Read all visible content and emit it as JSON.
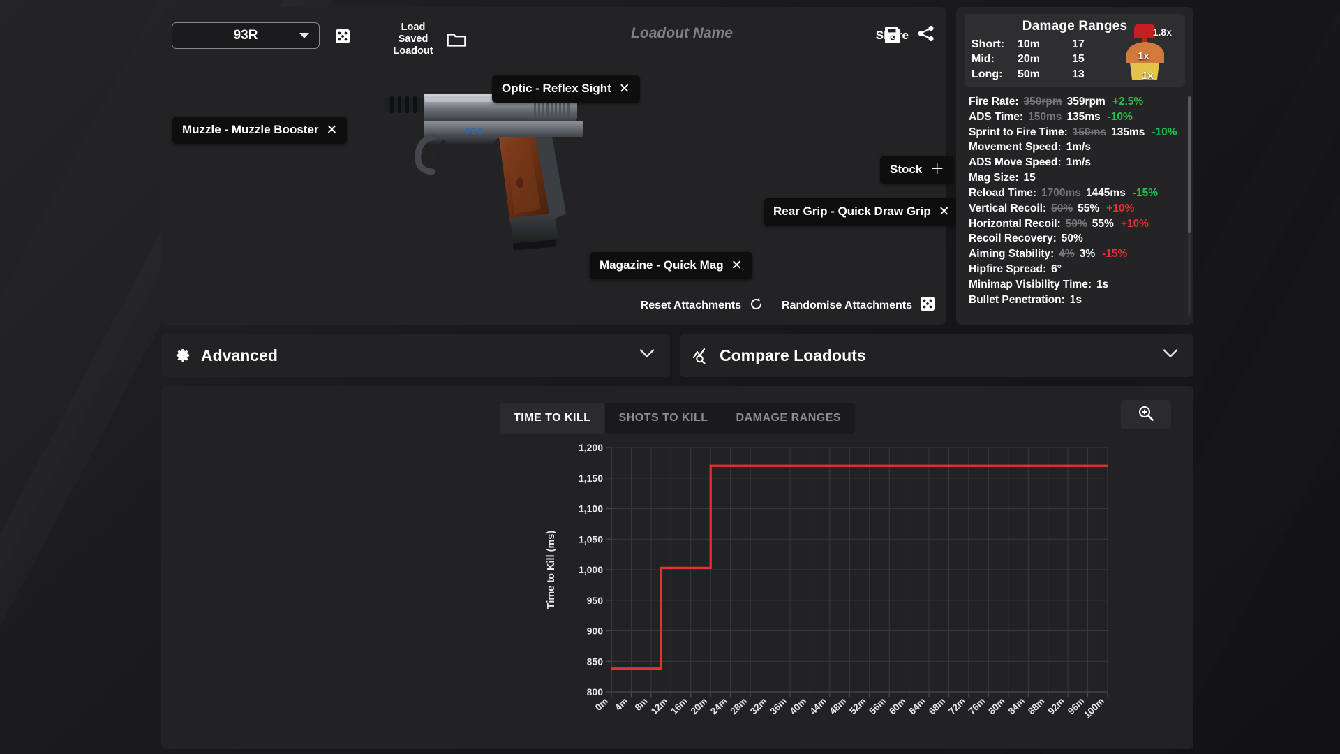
{
  "header": {
    "weapon_select": {
      "value": "93R",
      "icon": "dice-icon",
      "caret": "chevron-down-icon"
    },
    "load_saved": {
      "line1": "Load Saved",
      "line2": "Loadout",
      "icon": "folder-icon"
    },
    "loadout_name": {
      "value": "",
      "placeholder": "Loadout Name"
    },
    "save": {
      "icon": "floppy-save-icon"
    },
    "share": {
      "label": "Share",
      "icon": "share-icon"
    }
  },
  "attachments": [
    {
      "id": "muzzle",
      "label": "Muzzle - Muzzle Booster",
      "action": "remove",
      "glyph": "✕"
    },
    {
      "id": "optic",
      "label": "Optic - Reflex Sight",
      "action": "remove",
      "glyph": "✕"
    },
    {
      "id": "stock",
      "label": "Stock",
      "action": "add",
      "glyph": "＋"
    },
    {
      "id": "reargrip",
      "label": "Rear Grip - Quick Draw Grip",
      "action": "remove",
      "glyph": "✕"
    },
    {
      "id": "magazine",
      "label": "Magazine - Quick Mag",
      "action": "remove",
      "glyph": "✕"
    }
  ],
  "builder_actions": [
    {
      "id": "reset",
      "label": "Reset Attachments",
      "icon": "refresh-icon"
    },
    {
      "id": "randomise",
      "label": "Randomise Attachments",
      "icon": "dice-icon"
    }
  ],
  "damage_ranges": {
    "title": "Damage Ranges",
    "rows": [
      {
        "label": "Short:",
        "distance": "10m",
        "damage": "17"
      },
      {
        "label": "Mid:",
        "distance": "20m",
        "damage": "15"
      },
      {
        "label": "Long:",
        "distance": "50m",
        "damage": "13"
      }
    ],
    "hitbox": {
      "head": "1.8x",
      "body": "1x",
      "legs": "1x",
      "head_color": "#cc1f1f",
      "body_color": "#d8793d",
      "legs_color": "#e5c547"
    }
  },
  "stats": [
    {
      "name": "Fire Rate:",
      "old": "350rpm",
      "new": "359rpm",
      "delta": "+2.5%",
      "dir": "up"
    },
    {
      "name": "ADS Time:",
      "old": "150ms",
      "new": "135ms",
      "delta": "-10%",
      "dir": "up"
    },
    {
      "name": "Sprint to Fire Time:",
      "old": "150ms",
      "new": "135ms",
      "delta": "-10%",
      "dir": "up"
    },
    {
      "name": "Movement Speed:",
      "old": "",
      "new": "1m/s",
      "delta": "",
      "dir": ""
    },
    {
      "name": "ADS Move Speed:",
      "old": "",
      "new": "1m/s",
      "delta": "",
      "dir": ""
    },
    {
      "name": "Mag Size:",
      "old": "",
      "new": "15",
      "delta": "",
      "dir": ""
    },
    {
      "name": "Reload Time:",
      "old": "1700ms",
      "new": "1445ms",
      "delta": "-15%",
      "dir": "up"
    },
    {
      "name": "Vertical Recoil:",
      "old": "50%",
      "new": "55%",
      "delta": "+10%",
      "dir": "down"
    },
    {
      "name": "Horizontal Recoil:",
      "old": "50%",
      "new": "55%",
      "delta": "+10%",
      "dir": "down"
    },
    {
      "name": "Recoil Recovery:",
      "old": "",
      "new": "50%",
      "delta": "",
      "dir": ""
    },
    {
      "name": "Aiming Stability:",
      "old": "4%",
      "new": "3%",
      "delta": "-15%",
      "dir": "down"
    },
    {
      "name": "Hipfire Spread:",
      "old": "",
      "new": "6°",
      "delta": "",
      "dir": ""
    },
    {
      "name": "Minimap Visibility Time:",
      "old": "",
      "new": "1s",
      "delta": "",
      "dir": ""
    },
    {
      "name": "Bullet Penetration:",
      "old": "",
      "new": "1s",
      "delta": "",
      "dir": ""
    }
  ],
  "panels": [
    {
      "id": "advanced",
      "title": "Advanced",
      "icon": "gear-icon",
      "chevron": "chevron-down-icon"
    },
    {
      "id": "compare",
      "title": "Compare Loadouts",
      "icon": "chart-search-icon",
      "chevron": "chevron-down-icon"
    }
  ],
  "chart_tabs": [
    {
      "id": "ttk",
      "label": "TIME TO KILL",
      "active": true
    },
    {
      "id": "stk",
      "label": "SHOTS TO KILL",
      "active": false
    },
    {
      "id": "dmg",
      "label": "DAMAGE RANGES",
      "active": false
    }
  ],
  "chart_zoom_button": {
    "icon": "zoom-in-icon"
  },
  "chart_data": {
    "type": "line",
    "title": "",
    "xlabel": "",
    "ylabel": "Time to Kill (ms)",
    "line_color": "#e83030",
    "grid": true,
    "legend": "none",
    "step": "post",
    "xlim": [
      0,
      100
    ],
    "ylim": [
      800,
      1200
    ],
    "yticks": [
      800,
      850,
      900,
      950,
      1000,
      1050,
      1100,
      1150,
      1200
    ],
    "ytick_labels": [
      "800",
      "850",
      "900",
      "950",
      "1,000",
      "1,050",
      "1,100",
      "1,150",
      "1,200"
    ],
    "xticks": [
      0,
      4,
      8,
      12,
      16,
      20,
      24,
      28,
      32,
      36,
      40,
      44,
      48,
      52,
      56,
      60,
      64,
      68,
      72,
      76,
      80,
      84,
      88,
      92,
      96,
      100
    ],
    "xtick_labels": [
      "0m",
      "4m",
      "8m",
      "12m",
      "16m",
      "20m",
      "24m",
      "28m",
      "32m",
      "36m",
      "40m",
      "44m",
      "48m",
      "52m",
      "56m",
      "60m",
      "64m",
      "68m",
      "72m",
      "76m",
      "80m",
      "84m",
      "88m",
      "92m",
      "96m",
      "100m"
    ],
    "x": [
      0,
      10,
      10,
      20,
      20,
      100
    ],
    "values": [
      838,
      838,
      1003,
      1003,
      1170,
      1170
    ],
    "series": [
      {
        "name": "Time to Kill",
        "points": [
          [
            0,
            838
          ],
          [
            10,
            838
          ],
          [
            10,
            1003
          ],
          [
            20,
            1003
          ],
          [
            20,
            1170
          ],
          [
            100,
            1170
          ]
        ]
      }
    ]
  }
}
